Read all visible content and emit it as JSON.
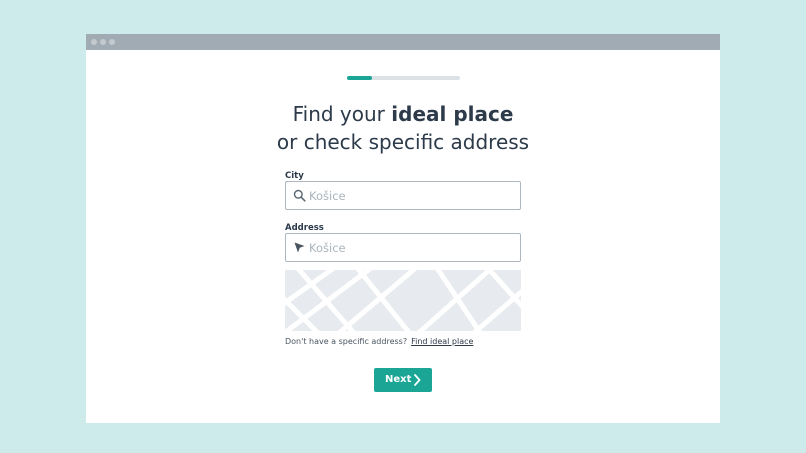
{
  "window": {
    "title_dots": [
      "dot",
      "dot",
      "dot"
    ]
  },
  "progress": {
    "step_fraction": 0.22
  },
  "heading": {
    "line1_prefix": "Find your ",
    "line1_bold": "ideal place",
    "line2": "or check specific address"
  },
  "city": {
    "label": "City",
    "placeholder": "Košice",
    "value": "",
    "icon": "search-icon"
  },
  "address": {
    "label": "Address",
    "placeholder": "Košice",
    "value": "",
    "icon": "location-arrow-icon"
  },
  "map": {
    "icon": "map-preview"
  },
  "hint": {
    "text": "Don't have a specific address?",
    "link": "Find ideal place"
  },
  "next_button": {
    "label": "Next",
    "icon": "chevron-right-icon"
  },
  "colors": {
    "background": "#cdebea",
    "accent": "#1aa595",
    "text": "#2c3a4a",
    "titlebar": "#a1abb3"
  }
}
